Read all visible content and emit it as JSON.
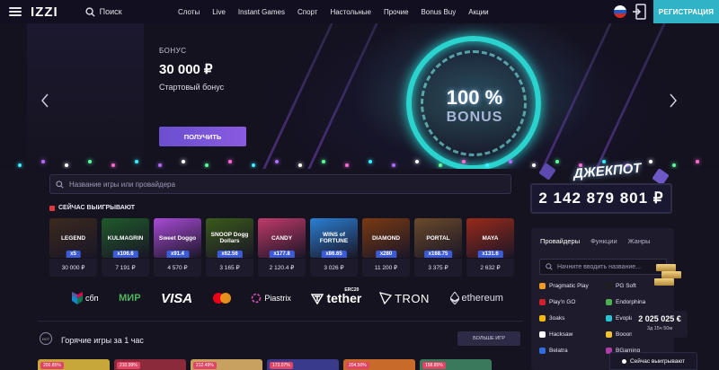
{
  "header": {
    "logo": "IZZI",
    "search_label": "Поиск",
    "nav": [
      "Слоты",
      "Live",
      "Instant Games",
      "Спорт",
      "Настольные",
      "Прочие",
      "Bonus Buy",
      "Акции"
    ],
    "register_label": "РЕГИСТРАЦИЯ"
  },
  "banner": {
    "label": "БОНУС",
    "amount": "30 000 ₽",
    "subtitle": "Стартовый бонус",
    "button": "ПОЛУЧИТЬ",
    "promo_percent": "100 %",
    "promo_word": "BONUS"
  },
  "game_search": {
    "placeholder": "Название игры или провайдера"
  },
  "winners": {
    "title": "СЕЙЧАС ВЫИГРЫВАЮТ",
    "items": [
      {
        "game": "LEGEND",
        "mult": "x5",
        "amount": "30 000 ₽",
        "color": "#3a2a1e"
      },
      {
        "game": "KULMAGRIN",
        "mult": "x106.6",
        "amount": "7 191 ₽",
        "color": "#1f5a2a"
      },
      {
        "game": "Sweet Doggo",
        "mult": "x91.4",
        "amount": "4 570 ₽",
        "color": "#a94bd6"
      },
      {
        "game": "SNOOP Dogg Dollars",
        "mult": "x62.56",
        "amount": "3 165 ₽",
        "color": "#3a5a1a"
      },
      {
        "game": "CANDY",
        "mult": "x177.8",
        "amount": "2 120.4 ₽",
        "color": "#c13a6a"
      },
      {
        "game": "WINS of FORTUNE",
        "mult": "x86.65",
        "amount": "3 026 ₽",
        "color": "#2a7fd4"
      },
      {
        "game": "DIAMOND",
        "mult": "x280",
        "amount": "11 200 ₽",
        "color": "#7a3a12"
      },
      {
        "game": "PORTAL",
        "mult": "x168.75",
        "amount": "3 375 ₽",
        "color": "#6a4a2a"
      },
      {
        "game": "MAYA",
        "mult": "x131.6",
        "amount": "2 632 ₽",
        "color": "#9a2a1a"
      }
    ]
  },
  "payments": [
    "сбп",
    "МИР",
    "VISA",
    "Mastercard",
    "Piastrix",
    "tether",
    "TRON",
    "ethereum"
  ],
  "payments_extra": {
    "tether_tag": "ERC20"
  },
  "hot": {
    "icon_label": "HOT",
    "title": "Горячие игры за 1 час",
    "more": "БОЛЬШЕ ИГР",
    "cards": [
      {
        "badge": "200.85%",
        "color": "#c7a73a"
      },
      {
        "badge": "210.99%",
        "color": "#8a2a3a"
      },
      {
        "badge": "212.49%",
        "color": "#c8a060"
      },
      {
        "badge": "173.07%",
        "color": "#3a3a8a"
      },
      {
        "badge": "204.50%",
        "color": "#c86a2a"
      },
      {
        "badge": "158.85%",
        "color": "#3a7a5a"
      }
    ]
  },
  "jackpot": {
    "title": "ДЖЕКПОТ",
    "amount": "2 142 879 801 ₽"
  },
  "providers": {
    "tabs": [
      "Провайдеры",
      "Функции",
      "Жанры"
    ],
    "search_placeholder": "Начните вводить название...",
    "list": [
      {
        "name": "Pragmatic Play",
        "color": "#f29b26"
      },
      {
        "name": "PG Soft",
        "color": "#1e1e1e"
      },
      {
        "name": "Play'n GO",
        "color": "#d11f2a"
      },
      {
        "name": "Endorphina",
        "color": "#4caf50"
      },
      {
        "name": "3oaks",
        "color": "#f5b800"
      },
      {
        "name": "Evoplay",
        "color": "#27c2d4"
      },
      {
        "name": "Hacksaw",
        "color": "#ffffff"
      },
      {
        "name": "Booongo",
        "color": "#f2c230"
      },
      {
        "name": "Belatra",
        "color": "#2f6de0"
      },
      {
        "name": "BGaming",
        "color": "#b03aa8"
      }
    ]
  },
  "popup": {
    "amount": "2 025 025 €",
    "time": "3д 15ч 50м"
  },
  "winning_now": "Сейчас выигрывают"
}
